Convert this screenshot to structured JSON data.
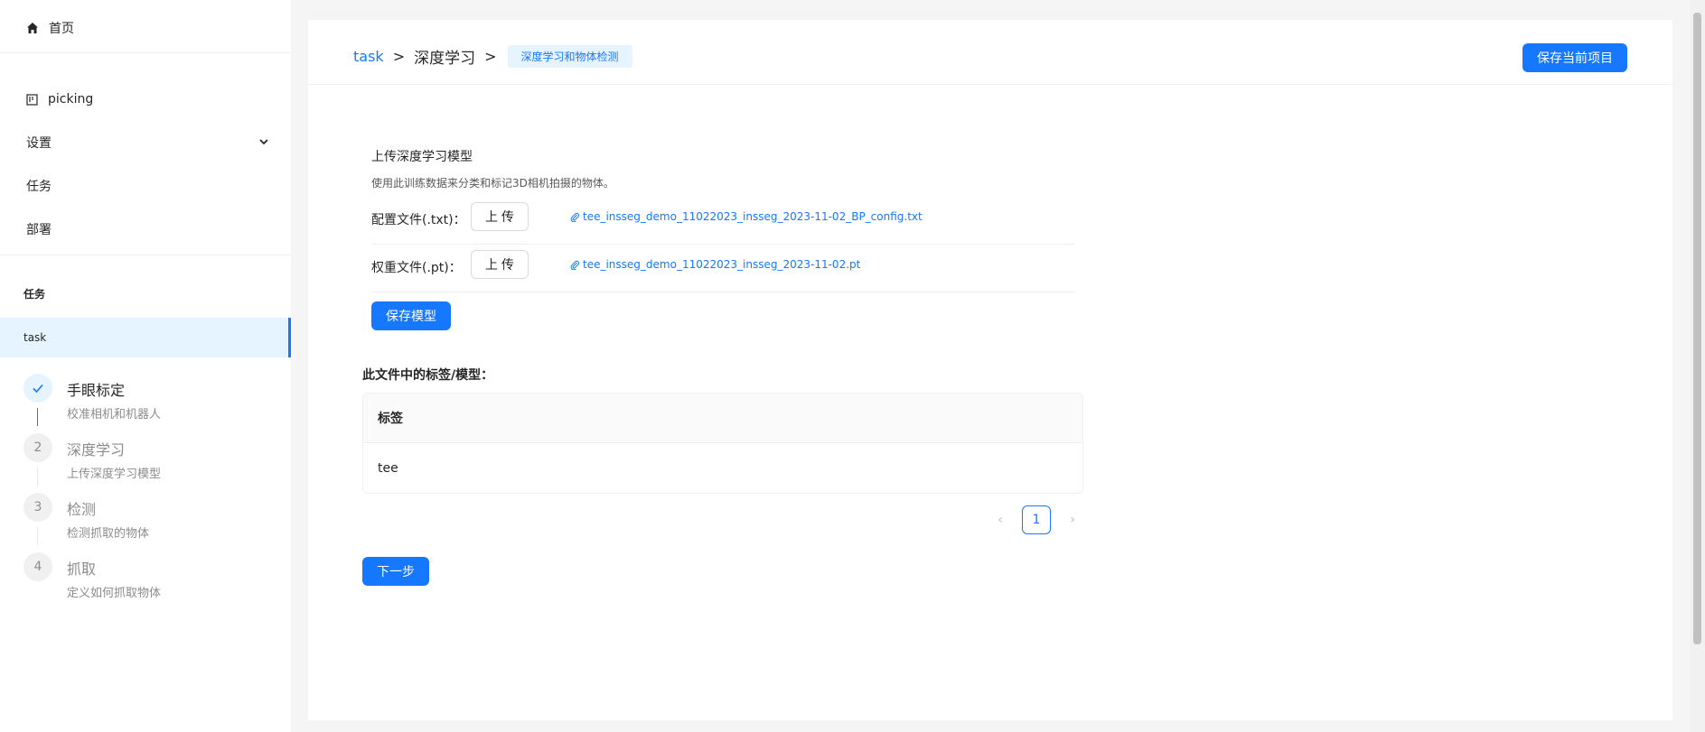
{
  "sidebar": {
    "home_label": "首页",
    "items": [
      {
        "label": "picking"
      },
      {
        "label": "设置"
      },
      {
        "label": "任务"
      },
      {
        "label": "部署"
      }
    ],
    "section_title": "任务",
    "active_task": "task",
    "steps": [
      {
        "number": "",
        "title": "手眼标定",
        "desc": "校准相机和机器人",
        "status": "done"
      },
      {
        "number": "2",
        "title": "深度学习",
        "desc": "上传深度学习模型",
        "status": "wait"
      },
      {
        "number": "3",
        "title": "检测",
        "desc": "检测抓取的物体",
        "status": "wait"
      },
      {
        "number": "4",
        "title": "抓取",
        "desc": "定义如何抓取物体",
        "status": "wait"
      }
    ]
  },
  "header": {
    "breadcrumb_root": "task",
    "breadcrumb_current": "深度学习",
    "breadcrumb_tag": "深度学习和物体检测",
    "save_project_label": "保存当前项目"
  },
  "model": {
    "title": "上传深度学习模型",
    "description": "使用此训练数据来分类和标记3D相机拍摄的物体。",
    "config_label": "配置文件(.txt)：",
    "config_upload": "上 传",
    "config_file": "tee_insseg_demo_11022023_insseg_2023-11-02_BP_config.txt",
    "weight_label": "权重文件(.pt)：",
    "weight_upload": "上 传",
    "weight_file": "tee_insseg_demo_11022023_insseg_2023-11-02.pt",
    "save_model_label": "保存模型"
  },
  "tags": {
    "title": "此文件中的标签/模型：",
    "column_header": "标签",
    "rows": [
      "tee"
    ]
  },
  "pagination": {
    "current_page": "1"
  },
  "next_step_label": "下一步",
  "colors": {
    "accent": "#1677ff",
    "accent_bg": "#e6f4ff"
  }
}
